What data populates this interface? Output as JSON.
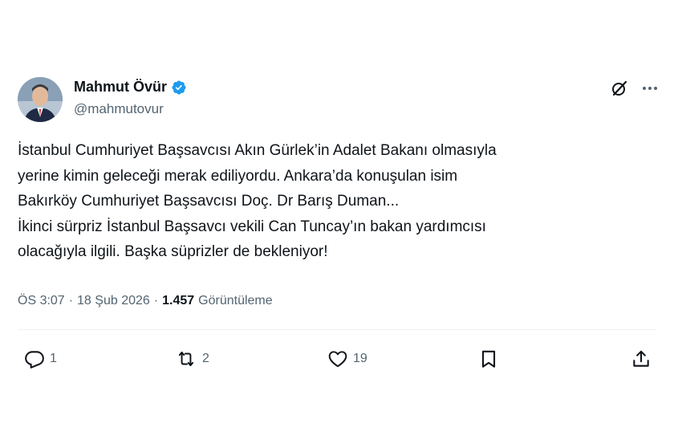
{
  "author": {
    "display_name": "Mahmut Övür",
    "handle": "@mahmutovur",
    "verified": true
  },
  "tweet": {
    "lines": [
      "İstanbul Cumhuriyet Başsavcısı Akın Gürlek’in Adalet Bakanı olmasıyla",
      "yerine kimin geleceği merak ediliyordu. Ankara’da konuşulan isim",
      "Bakırköy Cumhuriyet Başsavcısı Doç. Dr Barış Duman...",
      "İkinci sürpriz İstanbul Başsavcı vekili Can Tuncay’ın bakan yardımcısı",
      "olacağıyla ilgili. Başka süprizler de bekleniyor!"
    ],
    "time": "ÖS 3:07",
    "date": "18 Şub 2026",
    "separator": "·",
    "views_count": "1.457",
    "views_label": "Görüntüleme"
  },
  "actions": {
    "replies": "1",
    "reposts": "2",
    "likes": "19"
  },
  "icons": {
    "verified": "verified-badge-icon",
    "grok": "grok-icon",
    "more": "more-dots-icon",
    "reply": "reply-icon",
    "repost": "repost-icon",
    "like": "like-icon",
    "bookmark": "bookmark-icon",
    "share": "share-icon"
  },
  "colors": {
    "verified_blue": "#1d9bf0",
    "secondary_text": "#536471",
    "primary_text": "#0f1419"
  }
}
